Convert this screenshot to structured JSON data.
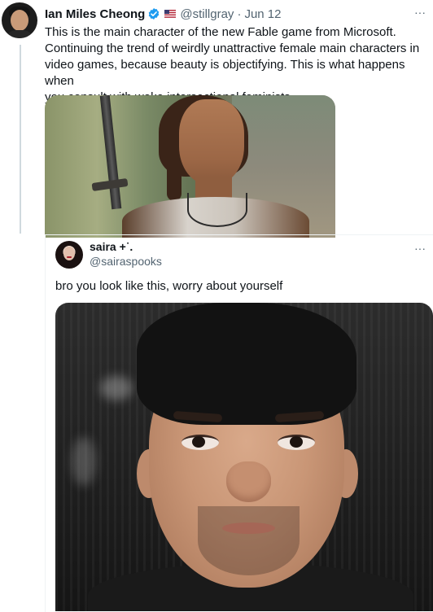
{
  "tweet": {
    "author_name": "Ian Miles Cheong",
    "handle": "@stillgray",
    "separator": "·",
    "date": "Jun 12",
    "more": "···",
    "text_lines": [
      "This is the main character of the new Fable game from Microsoft.",
      "Continuing the trend of weirdly unattractive female main characters in",
      "video games, because beauty is objectifying. This is what happens when",
      "you consult with woke intersectional feminists."
    ]
  },
  "quoted_tweet": {
    "author_name": "saira",
    "name_decoration": "+˙.",
    "handle": "@sairaspooks",
    "more": "···",
    "text": "bro you look like this, worry about yourself"
  },
  "colors": {
    "text_primary": "#0f1419",
    "text_secondary": "#536471",
    "verified_blue": "#1d9bf0",
    "thread_line": "#cfd9de"
  }
}
